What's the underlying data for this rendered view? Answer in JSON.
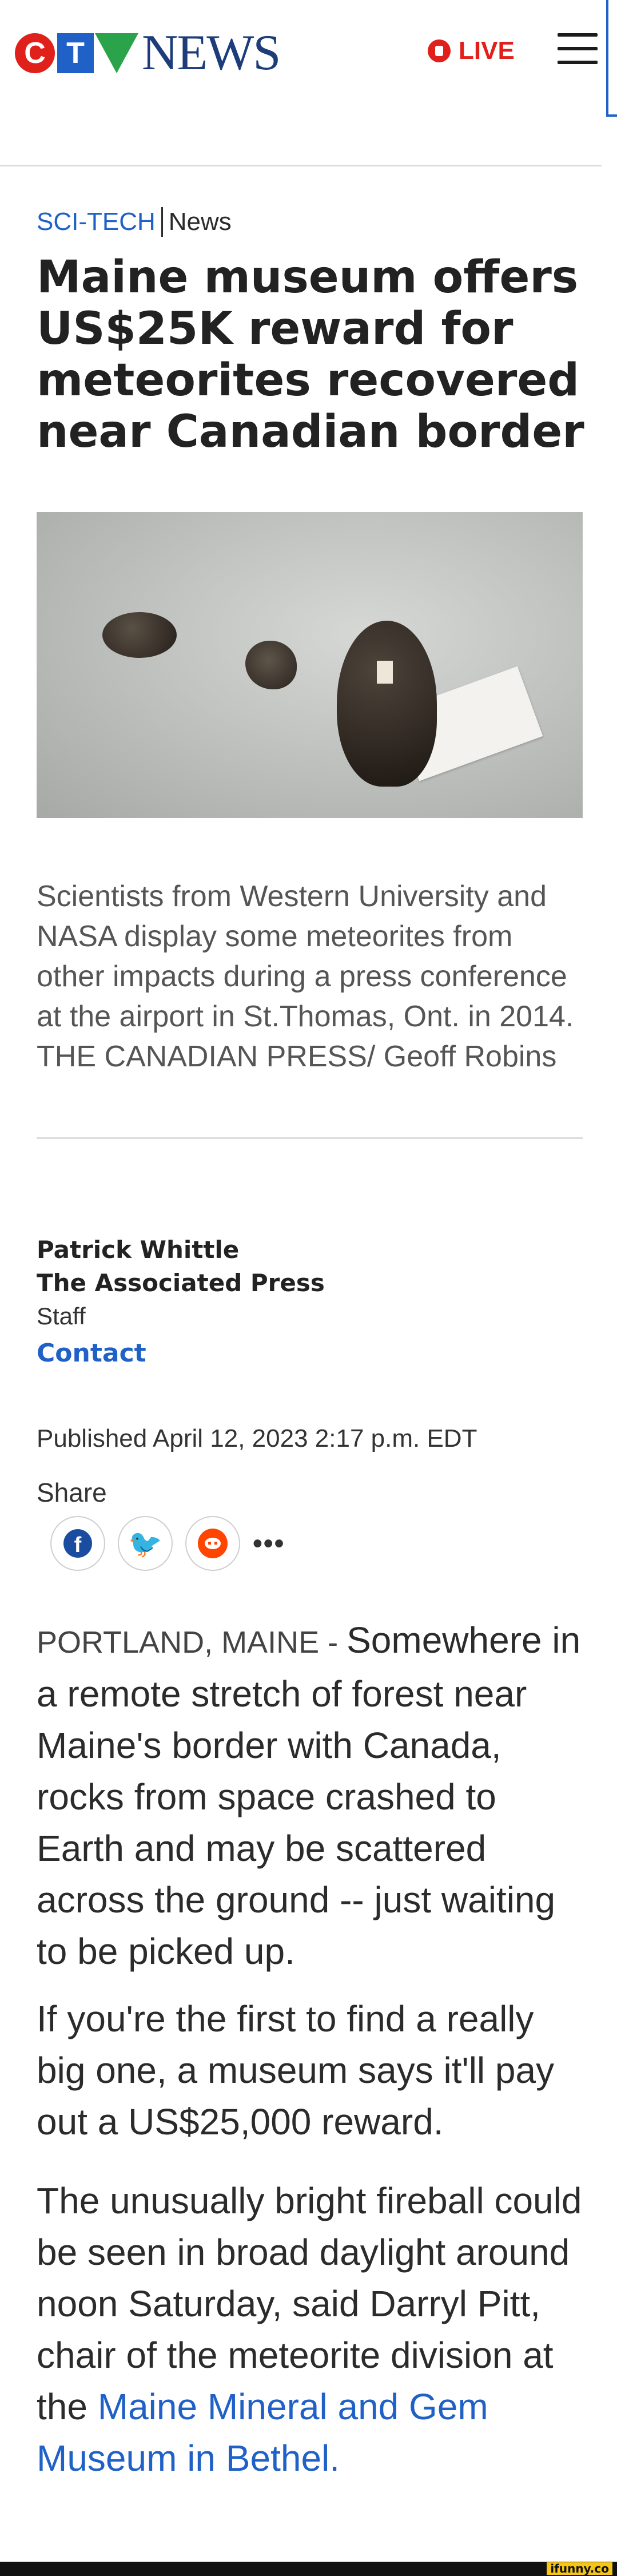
{
  "header": {
    "logo_text": "NEWS",
    "logo_letters": [
      "C",
      "T",
      "V"
    ],
    "live_label": "LIVE"
  },
  "breadcrumb": {
    "section": "SCI-TECH",
    "category": "News"
  },
  "article": {
    "headline": "Maine museum offers US$25K reward for meteorites recovered near Canadian border",
    "caption": "Scientists from Western University and NASA display some meteorites from other impacts during a press conference at the airport in St.Thomas, Ont. in 2014. THE CANADIAN PRESS/ Geoff Robins",
    "author_name": "Patrick Whittle",
    "author_org": "The Associated Press",
    "author_role": "Staff",
    "contact_label": "Contact",
    "published": "Published April 12, 2023 2:17 p.m. EDT",
    "share_label": "Share",
    "share_more": "•••",
    "dateline": "PORTLAND, MAINE - ",
    "p1": "Somewhere in a remote stretch of forest near Maine's border with Canada, rocks from space crashed to Earth and may be scattered across the ground -- just waiting to be picked up.",
    "p2": "If you're the first to find a really big one, a museum says it'll pay out a US$25,000 reward.",
    "p3": "The unusually bright fireball could be seen in broad daylight around noon Saturday, said Darryl Pitt, chair of the meteorite division at the ",
    "p3_link": "Maine Mineral and Gem Museum in Bethel."
  },
  "icons": {
    "facebook": "f",
    "twitter": "🐦"
  },
  "watermark": "ifunny.co",
  "colors": {
    "accent_blue": "#1f61c6",
    "live_red": "#e0201b"
  }
}
